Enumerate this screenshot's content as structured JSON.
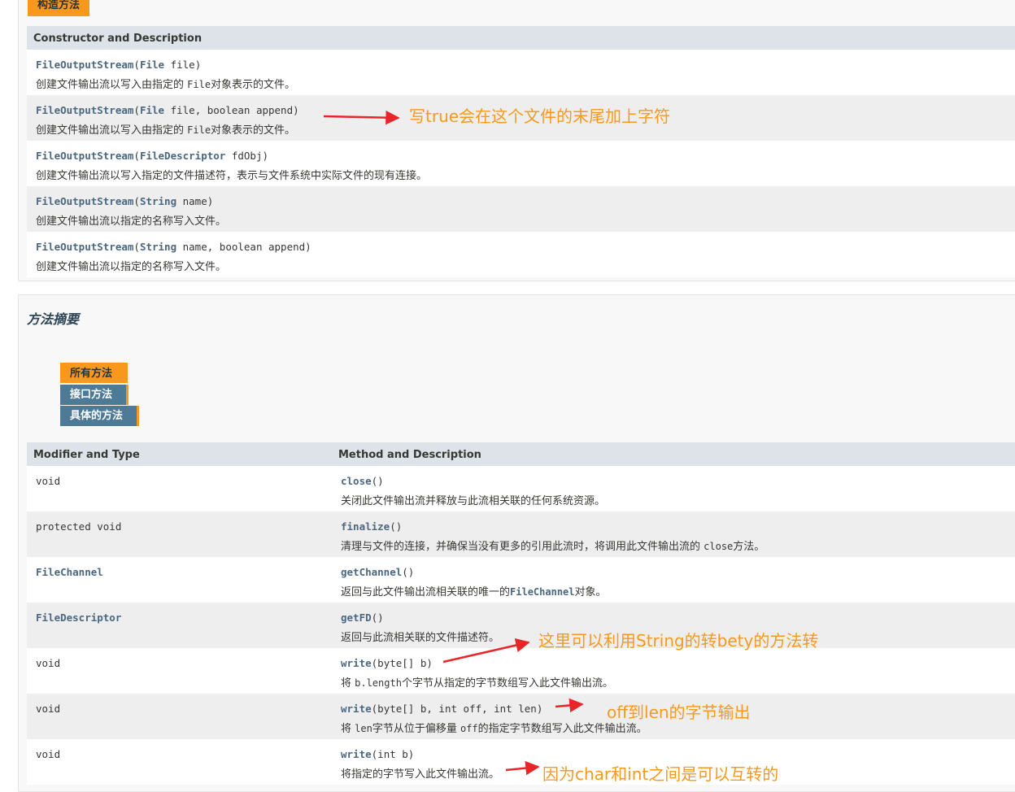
{
  "constructor_tab": {
    "label": "构造方法"
  },
  "constructor_table": {
    "header": "Constructor and Description",
    "rows": [
      {
        "name": "FileOutputStream",
        "open": "(",
        "type1": "File",
        "rest": " file)",
        "desc_a": "创建文件输出流以写入由指定的 ",
        "desc_code": "File",
        "desc_b": "对象表示的文件。"
      },
      {
        "name": "FileOutputStream",
        "open": "(",
        "type1": "File",
        "rest": " file, boolean append)",
        "desc_a": "创建文件输出流以写入由指定的 ",
        "desc_code": "File",
        "desc_b": "对象表示的文件。"
      },
      {
        "name": "FileOutputStream",
        "open": "(",
        "type1": "FileDescriptor",
        "rest": " fdObj)",
        "desc": "创建文件输出流以写入指定的文件描述符，表示与文件系统中实际文件的现有连接。"
      },
      {
        "name": "FileOutputStream",
        "open": "(",
        "type1": "String",
        "rest": " name)",
        "desc": "创建文件输出流以指定的名称写入文件。"
      },
      {
        "name": "FileOutputStream",
        "open": "(",
        "type1": "String",
        "rest": " name, boolean append)",
        "desc": "创建文件输出流以指定的名称写入文件。"
      }
    ]
  },
  "method_summary": {
    "title": "方法摘要",
    "tabs": [
      {
        "label": "所有方法"
      },
      {
        "label": "接口方法"
      },
      {
        "label": "具体的方法"
      }
    ],
    "header": {
      "col1": "Modifier and Type",
      "col2": "Method and Description"
    },
    "rows": [
      {
        "type": "void",
        "name": "close",
        "params": "()",
        "desc": "关闭此文件输出流并释放与此流相关联的任何系统资源。"
      },
      {
        "type": "protected void",
        "name": "finalize",
        "params": "()",
        "desc_a": "清理与文件的连接，并确保当没有更多的引用此流时，将调用此文件输出流的 ",
        "desc_code": "close",
        "desc_b": "方法。"
      },
      {
        "type": "FileChannel",
        "name": "getChannel",
        "params": "()",
        "desc_a": "返回与此文件输出流相关联的唯一的",
        "desc_code": "FileChannel",
        "desc_b": "对象。"
      },
      {
        "type": "FileDescriptor",
        "name": "getFD",
        "params": "()",
        "desc": "返回与此流相关联的文件描述符。"
      },
      {
        "type": "void",
        "name": "write",
        "params": "(byte[] b)",
        "desc_a": "将 ",
        "desc_code": "b.length",
        "desc_b": "个字节从指定的字节数组写入此文件输出流。"
      },
      {
        "type": "void",
        "name": "write",
        "params": "(byte[] b, int off, int len)",
        "desc_a": "将 ",
        "desc_code": "len",
        "desc_b": "字节从位于偏移量 ",
        "desc_code2": "off",
        "desc_c": "的指定字节数组写入此文件输出流。"
      },
      {
        "type": "void",
        "name": "write",
        "params": "(int b)",
        "desc": "将指定的字节写入此文件输出流。"
      }
    ]
  },
  "annotations": {
    "append_note": "写true会在这个文件的末尾加上字符",
    "bytes_note": "这里可以利用String的转bety的方法转",
    "offlen_note": "off到len的字节输出",
    "int_note": "因为char和int之间是可以互转的"
  },
  "colors": {
    "tab_orange": "#f8981d",
    "tab_blue": "#4d7a97",
    "header_bg": "#dee3e9",
    "link": "#4a6782",
    "annotation": "#f8981d",
    "arrow": "#e8262a"
  }
}
